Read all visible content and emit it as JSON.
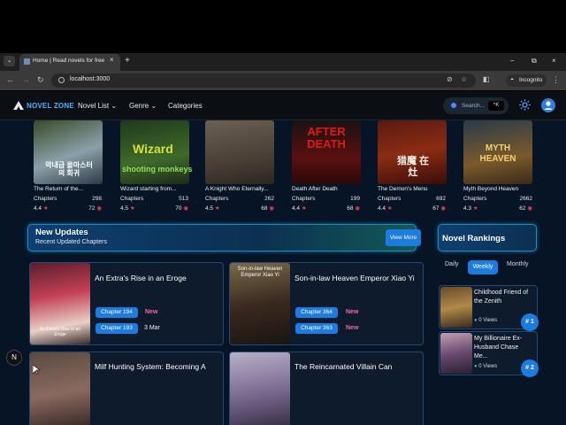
{
  "browser": {
    "tab_title": "Home | Read novels for free",
    "tab_close": "×",
    "new_tab": "+",
    "url": "localhost:3000",
    "incognito_label": "Incognito",
    "window_min": "–",
    "window_max": "⧉",
    "window_close": "×"
  },
  "header": {
    "logo": "NOVEL ZONE",
    "nav": [
      {
        "label": "Novel List"
      },
      {
        "label": "Genre"
      },
      {
        "label": "Categories"
      }
    ],
    "search_placeholder": "Search...",
    "search_shortcut": "^K"
  },
  "top_novels": [
    {
      "title": "The Return of the...",
      "chapters_label": "Chapters",
      "chapters": "298",
      "rating": "4.4",
      "views": "72"
    },
    {
      "title": "Wizard starting from...",
      "chapters_label": "Chapters",
      "chapters": "513",
      "rating": "4.5",
      "views": "70"
    },
    {
      "title": "A Knight Who Eternally...",
      "chapters_label": "Chapters",
      "chapters": "262",
      "rating": "4.5",
      "views": "68"
    },
    {
      "title": "Death After Death",
      "chapters_label": "Chapters",
      "chapters": "199",
      "rating": "4.4",
      "views": "68"
    },
    {
      "title": "The Demon's Menu",
      "chapters_label": "Chapters",
      "chapters": "692",
      "rating": "4.4",
      "views": "67"
    },
    {
      "title": "Myth Beyond Heaven",
      "chapters_label": "Chapters",
      "chapters": "2662",
      "rating": "4.3",
      "views": "62"
    }
  ],
  "cover_text": {
    "wizard": "Wizard",
    "wizard_sub": "shooting monkeys",
    "afterdeath": "AFTER DEATH",
    "demon": "猎魔 在灶",
    "myth": "MYTH HEAVEN",
    "korean": "악내급 올마스터의 회귀",
    "extra": "An Extra's Rise in an Eroge",
    "soninlaw": "Son-in-law Heaven Emperor Xiao Yi"
  },
  "new_updates": {
    "title": "New Updates",
    "subtitle": "Recent Updated Chapters",
    "view_more": "View More",
    "items": [
      {
        "title": "An Extra's Rise in an Eroge",
        "chapter1": "Chapter 194",
        "tag1": "New",
        "chapter2": "Chapter 193",
        "tag2": "3 Mar"
      },
      {
        "title": "Son-in-law Heaven Emperor Xiao Yi",
        "chapter1": "Chapter 364",
        "tag1": "New",
        "chapter2": "Chapter 363",
        "tag2": "New"
      },
      {
        "title": "Milf Hunting System: Becoming A"
      },
      {
        "title": "The Reincarnated Villain Can"
      }
    ]
  },
  "rankings": {
    "title": "Novel Rankings",
    "tabs": [
      "Daily",
      "Weekly",
      "Monthly"
    ],
    "active_tab": "Weekly",
    "items": [
      {
        "title": "Childhood Friend of the Zenith",
        "views": "0 Views",
        "rank": "# 1"
      },
      {
        "title": "My Billionaire Ex-Husband Chase Me...",
        "views": "0 Views",
        "rank": "# 2"
      }
    ]
  },
  "nextjs_badge": "N"
}
